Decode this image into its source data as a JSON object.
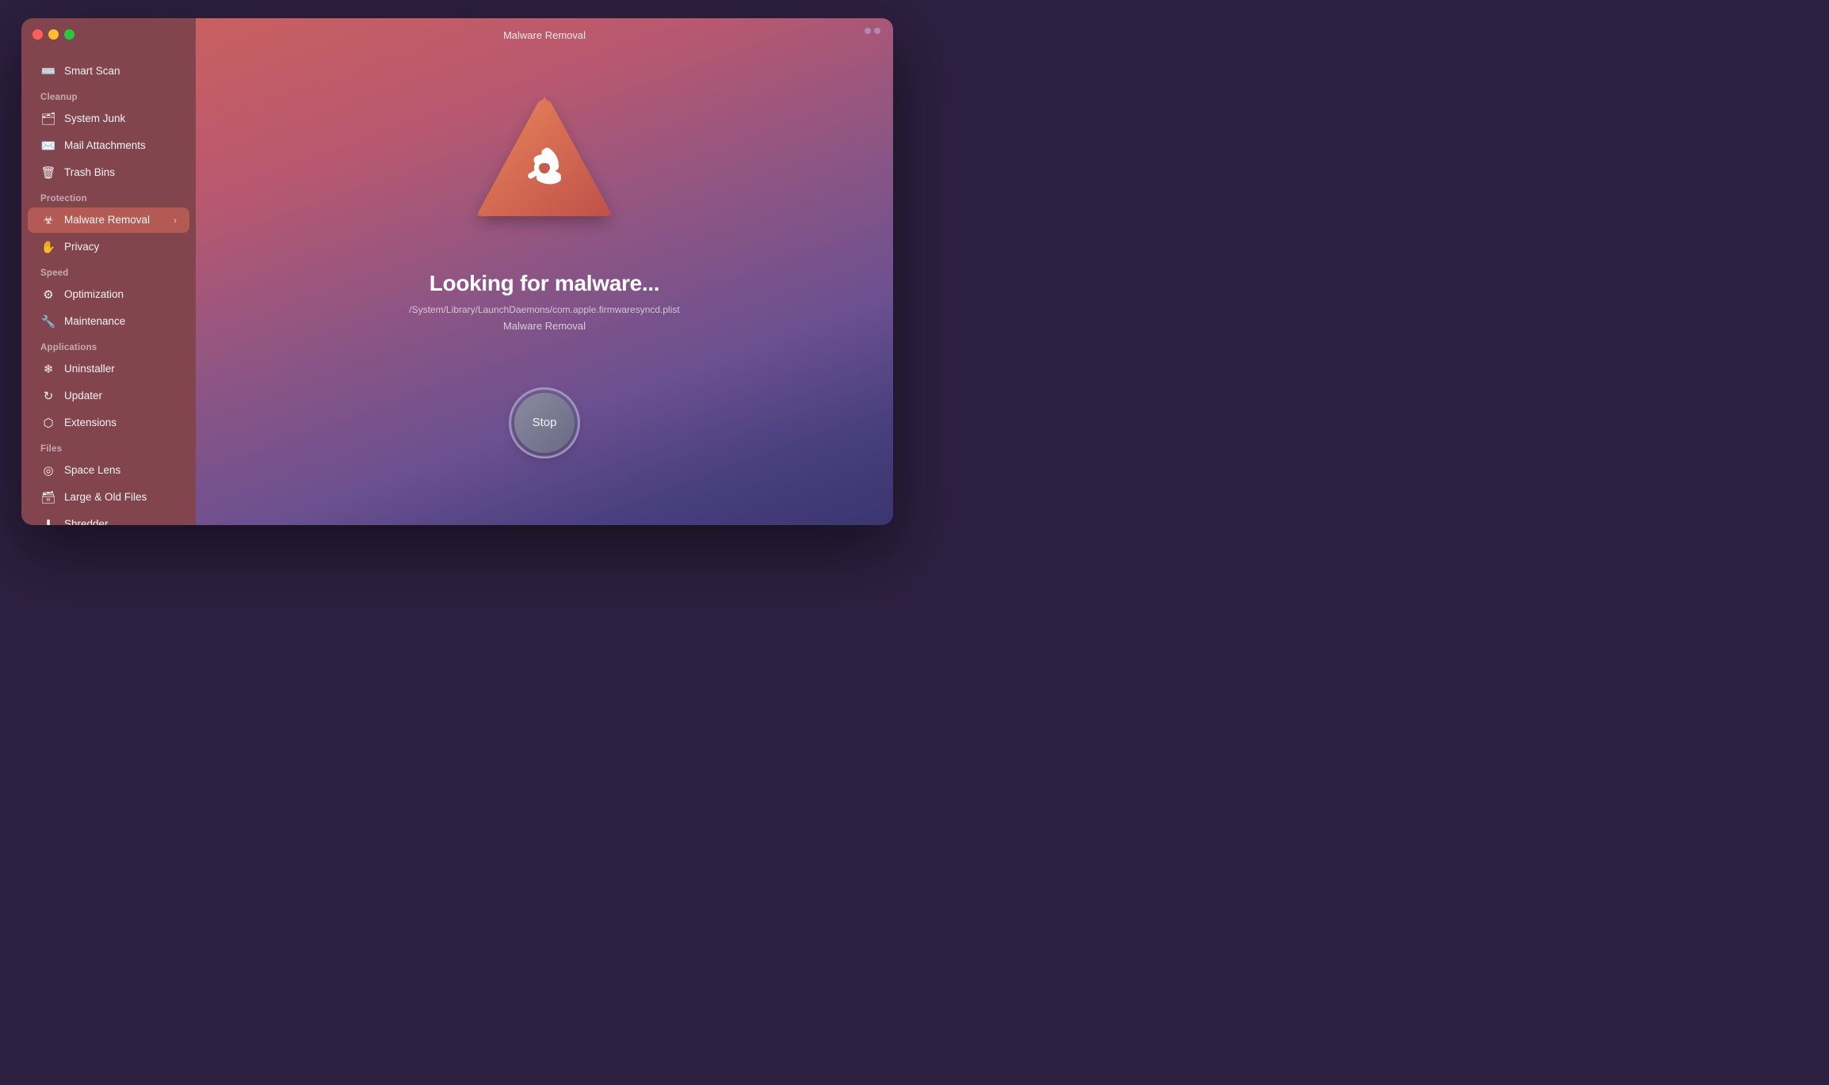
{
  "window": {
    "title": "Malware Removal"
  },
  "sidebar": {
    "smart_scan_label": "Smart Scan",
    "cleanup_label": "Cleanup",
    "system_junk_label": "System Junk",
    "mail_attachments_label": "Mail Attachments",
    "trash_bins_label": "Trash Bins",
    "protection_label": "Protection",
    "malware_removal_label": "Malware Removal",
    "privacy_label": "Privacy",
    "speed_label": "Speed",
    "optimization_label": "Optimization",
    "maintenance_label": "Maintenance",
    "applications_label": "Applications",
    "uninstaller_label": "Uninstaller",
    "updater_label": "Updater",
    "extensions_label": "Extensions",
    "files_label": "Files",
    "space_lens_label": "Space Lens",
    "large_old_files_label": "Large & Old Files",
    "shredder_label": "Shredder"
  },
  "main": {
    "scan_title": "Looking for malware...",
    "scan_path": "/System/Library/LaunchDaemons/com.apple.firmwaresyncd.plist",
    "scan_subtitle": "Malware Removal",
    "stop_label": "Stop"
  }
}
